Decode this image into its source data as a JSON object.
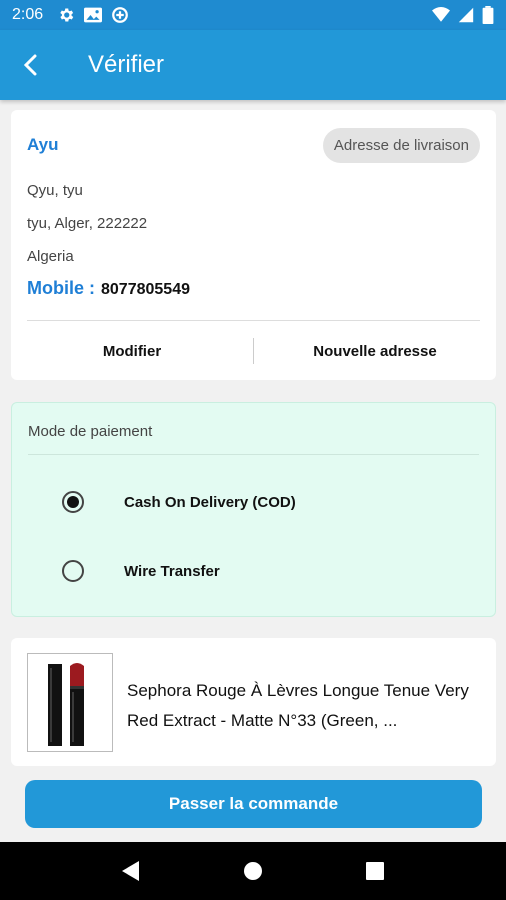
{
  "status_bar": {
    "time": "2:06"
  },
  "app_bar": {
    "title": "Vérifier"
  },
  "address": {
    "name": "Ayu",
    "tag": "Adresse de livraison",
    "line1": "Qyu, tyu",
    "line2": "tyu, Alger, 222222",
    "line3": "Algeria",
    "mobile_label": "Mobile :",
    "mobile_value": "8077805549",
    "edit_label": "Modifier",
    "new_address_label": "Nouvelle adresse"
  },
  "payment": {
    "title": "Mode de paiement",
    "options": [
      {
        "label": "Cash On Delivery (COD)",
        "selected": true
      },
      {
        "label": "Wire Transfer",
        "selected": false
      }
    ]
  },
  "product": {
    "name": "Sephora Rouge À Lèvres Longue Tenue Very Red Extract - Matte N°33 (Green, ..."
  },
  "order_button": {
    "label": "Passer la commande"
  },
  "colors": {
    "primary": "#2298d8",
    "accent_text": "#1f7fd6",
    "payment_bg": "#e3fbf2"
  }
}
